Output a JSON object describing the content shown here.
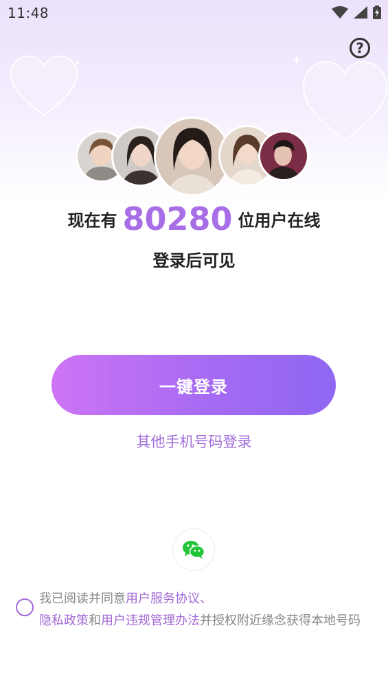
{
  "status_bar": {
    "time": "11:48"
  },
  "help_icon": "question-circle-icon",
  "online": {
    "prefix": "现在有",
    "count": "80280",
    "suffix": "位用户在线"
  },
  "subtitle": "登录后可见",
  "one_click_login": "一键登录",
  "other_phone_login": "其他手机号码登录",
  "wechat_icon": "wechat-icon",
  "agreement": {
    "text1": "我已阅读并同意",
    "link1": "用户服务协议",
    "sep1": "、",
    "link2": "隐私政策",
    "text2": "和",
    "link3": "用户违规管理办法",
    "text3": "并授权附近缘念获得本地号码"
  },
  "colors": {
    "accent": "#a86ee6",
    "button_start": "#cd74f5",
    "button_end": "#8f67f2",
    "link": "#a26ad6"
  }
}
